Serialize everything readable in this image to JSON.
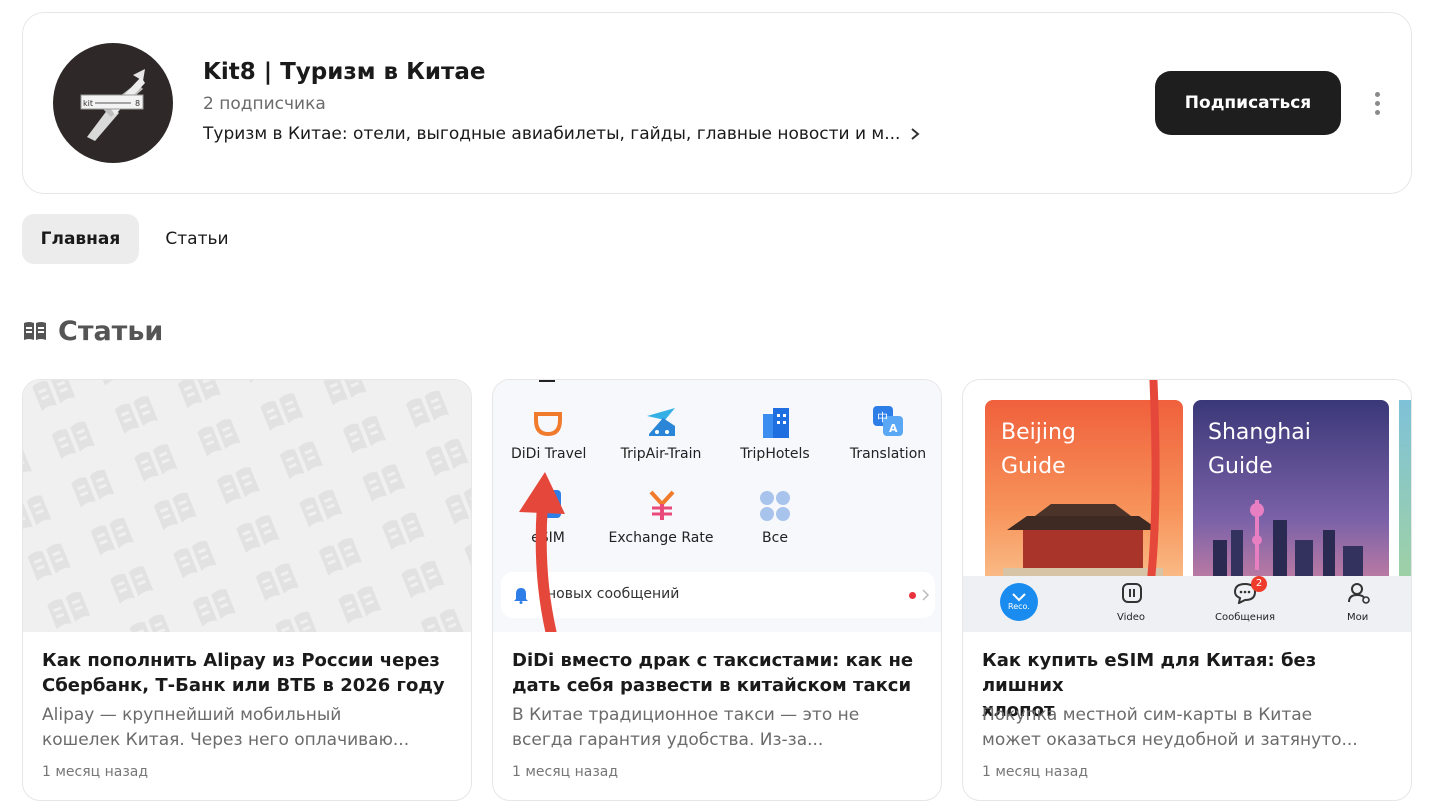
{
  "channel": {
    "title": "Kit8 | Туризм в Китае",
    "subscribers": "2 подписчика",
    "description": "Туризм в Китае: отели, выгодные авиабилеты, гайды, главные новости и м...",
    "subscribe_label": "Подписаться",
    "avatar_text_left": "kit",
    "avatar_text_right": "8"
  },
  "tabs": [
    {
      "label": "Главная",
      "active": true
    },
    {
      "label": "Статьи",
      "active": false
    }
  ],
  "section": {
    "title": "Статьи",
    "icon": "book-icon"
  },
  "articles": [
    {
      "title_lines": [
        "Как пополнить Alipay из России через",
        "Сбербанк, Т-Банк или ВТБ в 2026 году"
      ],
      "excerpt_lines": [
        "Alipay — крупнейший мобильный",
        "кошелек Китая. Через него оплачиваю..."
      ],
      "date": "1 месяц назад"
    },
    {
      "title_lines": [
        "DiDi вместо драк с таксистами: как не",
        "дать себя развести в китайском такси"
      ],
      "excerpt_lines": [
        "В Китае традиционное такси — это не",
        "всегда гарантия удобства. Из-за..."
      ],
      "date": "1 месяц назад",
      "image": {
        "apps": [
          "DiDi Travel",
          "TripAir-Train",
          "TripHotels",
          "Translation",
          "eSIM",
          "Exchange Rate",
          "Все"
        ],
        "notification": "новых сообщений"
      }
    },
    {
      "title_lines": [
        "Как купить eSIM для Китая: без лишних",
        "хлопот"
      ],
      "excerpt_lines": [
        "Покупка местной сим-карты в Китае",
        "может оказаться неудобной и затянуто..."
      ],
      "date": "1 месяц назад",
      "image": {
        "guide_left": [
          "Beijing",
          "Guide"
        ],
        "guide_right": [
          "Shanghai",
          "Guide"
        ],
        "tabbar": [
          "Reco.",
          "Video",
          "Сообщения",
          "Мои"
        ],
        "badge": "2"
      }
    }
  ],
  "colors": {
    "button_bg": "#1e1e1f",
    "active_tab_bg": "#ececec",
    "arrow_red": "#e5473a"
  }
}
